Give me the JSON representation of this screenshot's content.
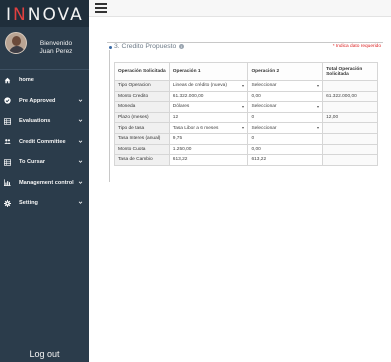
{
  "brand": {
    "logo_prefix": "I",
    "logo_accent": "N",
    "logo_rest": "NOVA"
  },
  "user": {
    "welcome_line1": "Bienvenido",
    "welcome_line2": "Juan Perez"
  },
  "sidebar": {
    "items": [
      {
        "label": "home",
        "icon": "home-icon",
        "has_chevron": false
      },
      {
        "label": "Pre Approved",
        "icon": "check-circle-icon",
        "has_chevron": true
      },
      {
        "label": "Evaluations",
        "icon": "table-icon",
        "has_chevron": true
      },
      {
        "label": "Credit Committee",
        "icon": "users-icon",
        "has_chevron": true
      },
      {
        "label": "To Cursar",
        "icon": "table-icon",
        "has_chevron": true
      },
      {
        "label": "Management control",
        "icon": "bar-chart-icon",
        "has_chevron": true
      },
      {
        "label": "Setting",
        "icon": "gear-icon",
        "has_chevron": true
      }
    ],
    "logout_label": "Log out"
  },
  "panel": {
    "title": "3. Credito Propuesto",
    "required_note": "* Indica dato requerido",
    "headers": {
      "label": "Operación Solicitada",
      "op1": "Operación 1",
      "op2": "Operación 2",
      "total": "Total Operación Solicitada"
    },
    "rows": [
      {
        "label": "Tipo Operacion",
        "op1": "Lineas de crédito (nueva)",
        "op1_select": true,
        "op2": "Seleccionar",
        "op2_select": true,
        "total": ""
      },
      {
        "label": "Monto Credito",
        "op1": "61.322.000,00",
        "op1_select": false,
        "op2": "0,00",
        "op2_select": false,
        "total": "61.322.000,00"
      },
      {
        "label": "Moneda",
        "op1": "Dólares",
        "op1_select": true,
        "op2": "Seleccionar",
        "op2_select": true,
        "total": ""
      },
      {
        "label": "Plazo (meses)",
        "op1": "12",
        "op1_select": false,
        "op2": "0",
        "op2_select": false,
        "total": "12,00"
      },
      {
        "label": "Tipo de tasa",
        "op1": "Tasa Libor a 6 meses",
        "op1_select": true,
        "op2": "Seleccionar",
        "op2_select": true,
        "total": ""
      },
      {
        "label": "Tasa Interes (anual)",
        "op1": "9,75",
        "op1_select": false,
        "op2": "0",
        "op2_select": false,
        "total": ""
      },
      {
        "label": "Monto Cuota",
        "op1": "1.250,00",
        "op1_select": false,
        "op2": "0,00",
        "op2_select": false,
        "total": ""
      },
      {
        "label": "Tasa de Cambio",
        "op1": "613,22",
        "op1_select": false,
        "op2": "613,22",
        "op2_select": false,
        "total": ""
      }
    ]
  },
  "colors": {
    "sidebar_bg": "#2b3c4b",
    "logo_bg": "#1f2e3b",
    "accent_red": "#e04040",
    "required_red": "#dd2222"
  }
}
